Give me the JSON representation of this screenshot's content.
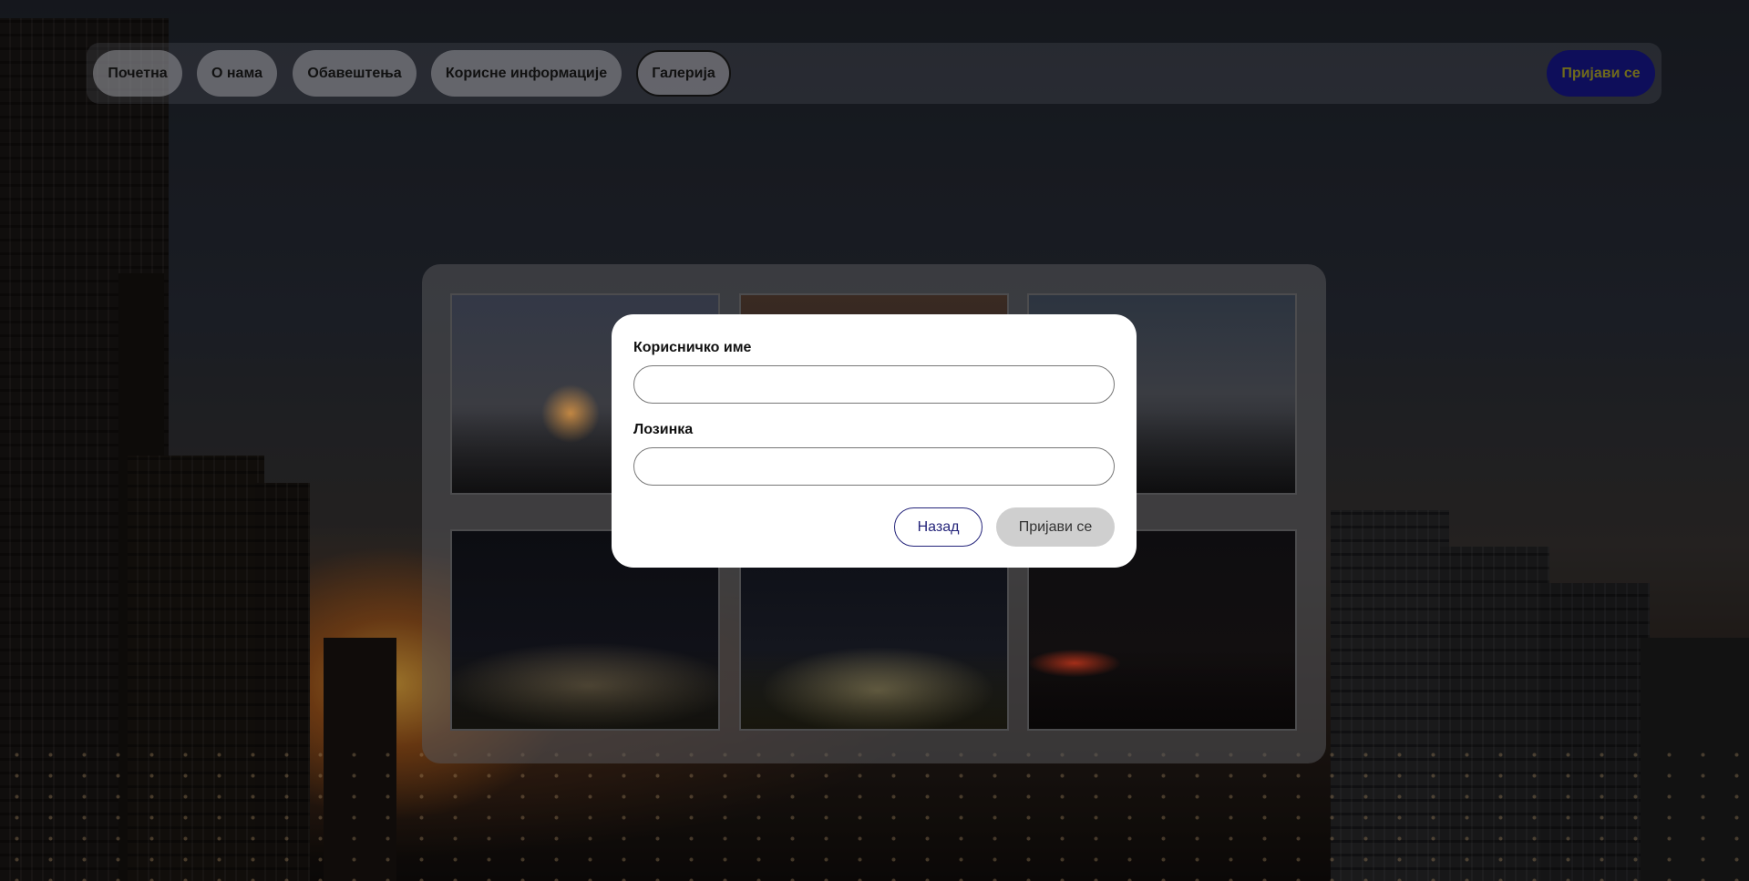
{
  "nav": {
    "items": [
      {
        "label": "Почетна"
      },
      {
        "label": "О нама"
      },
      {
        "label": "Обавештења"
      },
      {
        "label": "Корисне информације"
      },
      {
        "label": "Галерија"
      }
    ],
    "active": "Галерија",
    "login_label": "Пријави се"
  },
  "gallery": {
    "photos": [
      "photo-1",
      "photo-2",
      "photo-3",
      "photo-4",
      "photo-5",
      "photo-6"
    ]
  },
  "login_modal": {
    "username_label": "Корисничко име",
    "username_value": "",
    "password_label": "Лозинка",
    "password_value": "",
    "back_label": "Назад",
    "submit_label": "Пријави се"
  },
  "colors": {
    "nav_login_bg": "#0e0e5a",
    "nav_login_text": "#6f6a1c",
    "back_border": "#24247a",
    "submit_bg": "#cfcfcf"
  }
}
